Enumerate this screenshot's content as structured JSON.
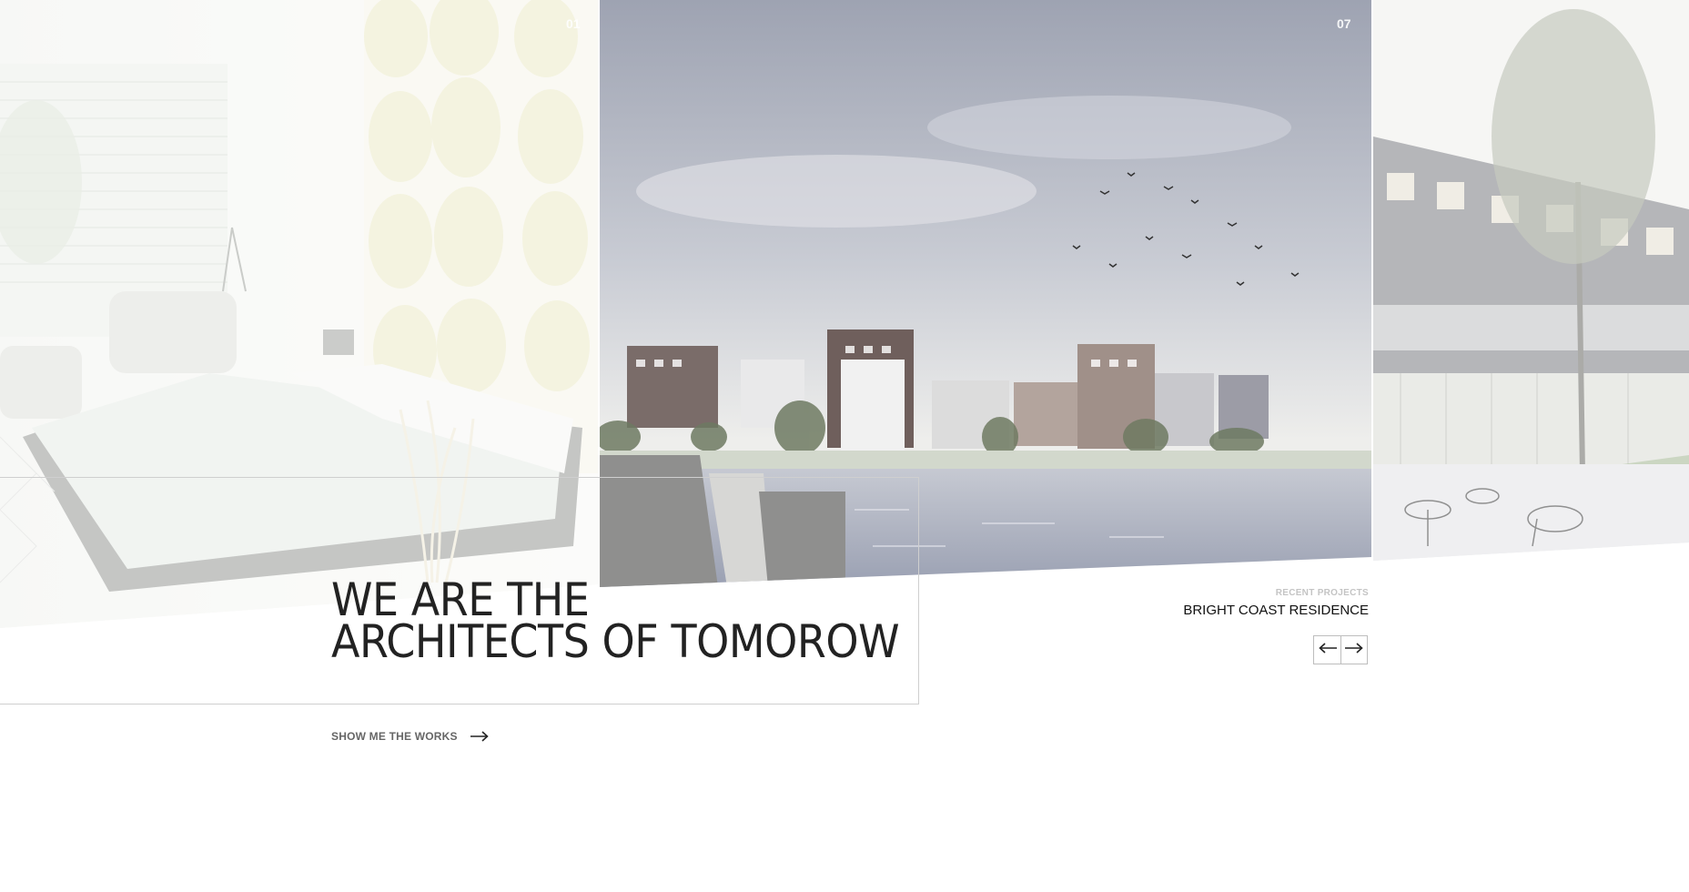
{
  "slides": [
    {
      "number": "01",
      "subject": "interior-bedroom-image"
    },
    {
      "number": "07",
      "subject": "waterfront-residence-image"
    },
    {
      "subject": "building-courtyard-image"
    }
  ],
  "hero": {
    "title_line1": "WE ARE THE",
    "title_line2": "ARCHITECTS OF TOMOROW"
  },
  "cta": {
    "label": "SHOW ME THE WORKS",
    "icon": "arrow-right-icon"
  },
  "recent": {
    "label": "RECENT PROJECTS",
    "project_name": "BRIGHT COAST RESIDENCE"
  },
  "nav": {
    "prev_icon": "arrow-left-icon",
    "next_icon": "arrow-right-icon"
  },
  "colors": {
    "title": "#222222",
    "cta": "#666666",
    "label_muted": "#c4c4c4",
    "frame": "#cfcfcf"
  }
}
